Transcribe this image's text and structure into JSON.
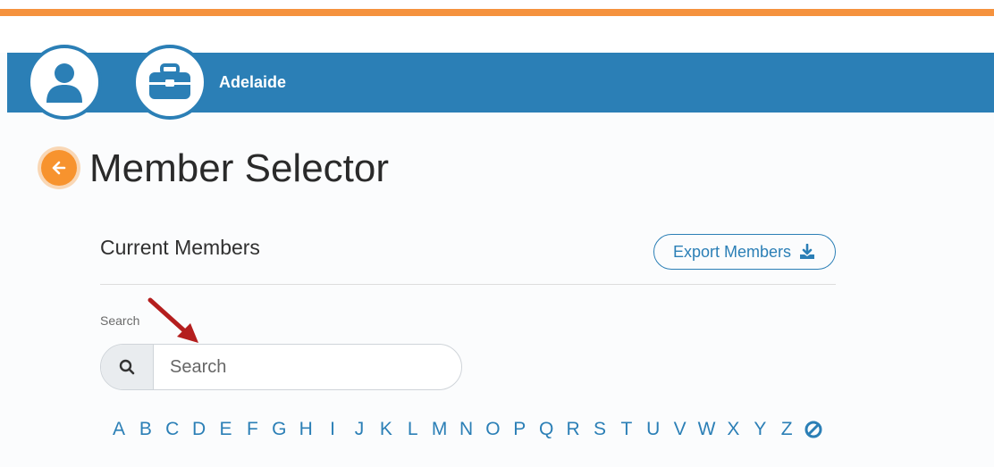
{
  "header": {
    "org_name": "Adelaide",
    "icons": [
      "user-icon",
      "briefcase-icon"
    ],
    "colors": {
      "bar": "#2b7fb6",
      "accent_line": "#f5923e"
    }
  },
  "page": {
    "title": "Member Selector",
    "back_icon": "arrow-left-icon",
    "back_color": "#f7932e"
  },
  "section": {
    "title": "Current Members",
    "export_label": "Export Members",
    "export_icon": "download-icon"
  },
  "search": {
    "label": "Search",
    "placeholder": "Search",
    "value": "",
    "icon": "search-icon"
  },
  "alphabet": {
    "letters": [
      "A",
      "B",
      "C",
      "D",
      "E",
      "F",
      "G",
      "H",
      "I",
      "J",
      "K",
      "L",
      "M",
      "N",
      "O",
      "P",
      "Q",
      "R",
      "S",
      "T",
      "U",
      "V",
      "W",
      "X",
      "Y",
      "Z"
    ],
    "clear_icon": "clear-filter-icon",
    "color": "#2b7fb6"
  }
}
